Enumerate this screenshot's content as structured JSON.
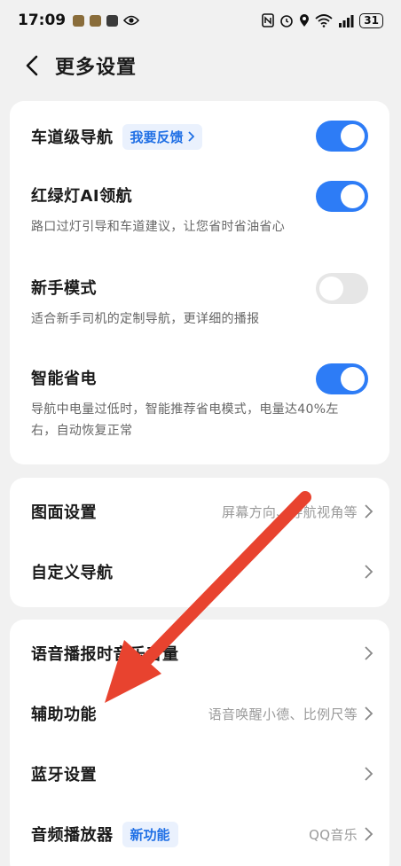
{
  "status_bar": {
    "time": "17:09",
    "battery": "31"
  },
  "header": {
    "title": "更多设置"
  },
  "card1": {
    "lane_nav": {
      "title": "车道级导航",
      "badge": "我要反馈",
      "enabled": true
    },
    "traffic_light": {
      "title": "红绿灯AI领航",
      "desc": "路口过灯引导和车道建议，让您省时省油省心",
      "enabled": true
    },
    "novice": {
      "title": "新手模式",
      "desc": "适合新手司机的定制导航，更详细的播报",
      "enabled": false
    },
    "power_save": {
      "title": "智能省电",
      "desc_line1": "导航中电量过低时，智能推荐省电模式，电量达40%左",
      "desc_line2": "右，自动恢复正常",
      "enabled": true
    }
  },
  "card2": {
    "display": {
      "title": "图面设置",
      "value": "屏幕方向、导航视角等"
    },
    "custom_nav": {
      "title": "自定义导航"
    }
  },
  "card3": {
    "voice_music": {
      "title": "语音播报时音乐音量"
    },
    "assist": {
      "title": "辅助功能",
      "value": "语音唤醒小德、比例尺等"
    },
    "bluetooth": {
      "title": "蓝牙设置"
    },
    "audio_player": {
      "title": "音频播放器",
      "badge": "新功能",
      "value": "QQ音乐"
    }
  },
  "colors": {
    "accent": "#2d7cf6",
    "annotation_arrow": "#e8432f"
  }
}
